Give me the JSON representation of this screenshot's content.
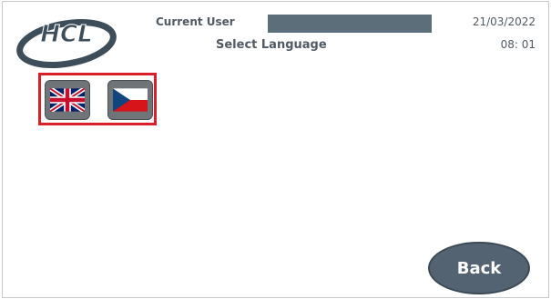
{
  "header": {
    "logo_text": "HCL",
    "current_user_label": "Current User",
    "current_user_value": "",
    "title": "Select Language",
    "date": "21/03/2022",
    "time": "08: 01"
  },
  "languages": [
    {
      "name": "english",
      "icon": "uk-flag-icon"
    },
    {
      "name": "czech",
      "icon": "czech-flag-icon"
    }
  ],
  "footer": {
    "back_label": "Back"
  },
  "colors": {
    "selection_border": "#d81f2a",
    "button": "#536372",
    "text": "#505a64"
  }
}
